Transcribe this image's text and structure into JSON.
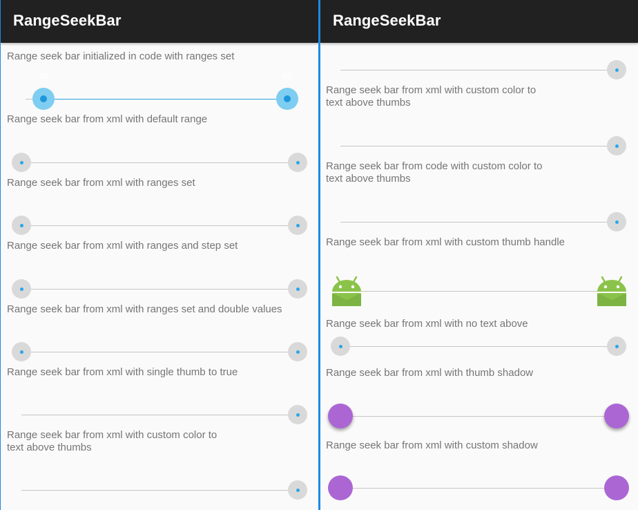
{
  "app": {
    "title": "RangeSeekBar"
  },
  "left": {
    "rows": [
      {
        "label": "Range seek bar initialized in code with ranges set",
        "min_value": "20",
        "max_value": "88"
      },
      {
        "label": "Range seek bar from xml with default range"
      },
      {
        "label": "Range seek bar from xml with ranges set"
      },
      {
        "label": "Range seek bar from xml with ranges and step set"
      },
      {
        "label": "Range seek bar from xml with ranges set and double values"
      },
      {
        "label": "Range seek bar from xml with single thumb to true"
      },
      {
        "label_line1": "Range seek bar from xml with custom color to",
        "label_line2": "text above thumbs"
      }
    ]
  },
  "right": {
    "rows": [
      {
        "label_line1": "Range seek bar from xml with custom color to",
        "label_line2": "text above thumbs"
      },
      {
        "label_line1": "Range seek bar from code with custom color to",
        "label_line2": "text above thumbs"
      },
      {
        "label": "Range seek bar from xml with custom thumb handle"
      },
      {
        "label": "Range seek bar from xml with no text above"
      },
      {
        "label": "Range seek bar from xml with thumb shadow"
      },
      {
        "label": "Range seek bar from xml with custom shadow"
      }
    ]
  },
  "colors": {
    "appbar": "#212121",
    "background": "#fafafa",
    "accent_blue": "#29a3e2",
    "thumb_grey": "#d9d9d9",
    "thumb_purple": "#ab66d4",
    "android_green": "#8bc34a"
  },
  "icons": {
    "custom_thumb": "android-robot-icon"
  }
}
